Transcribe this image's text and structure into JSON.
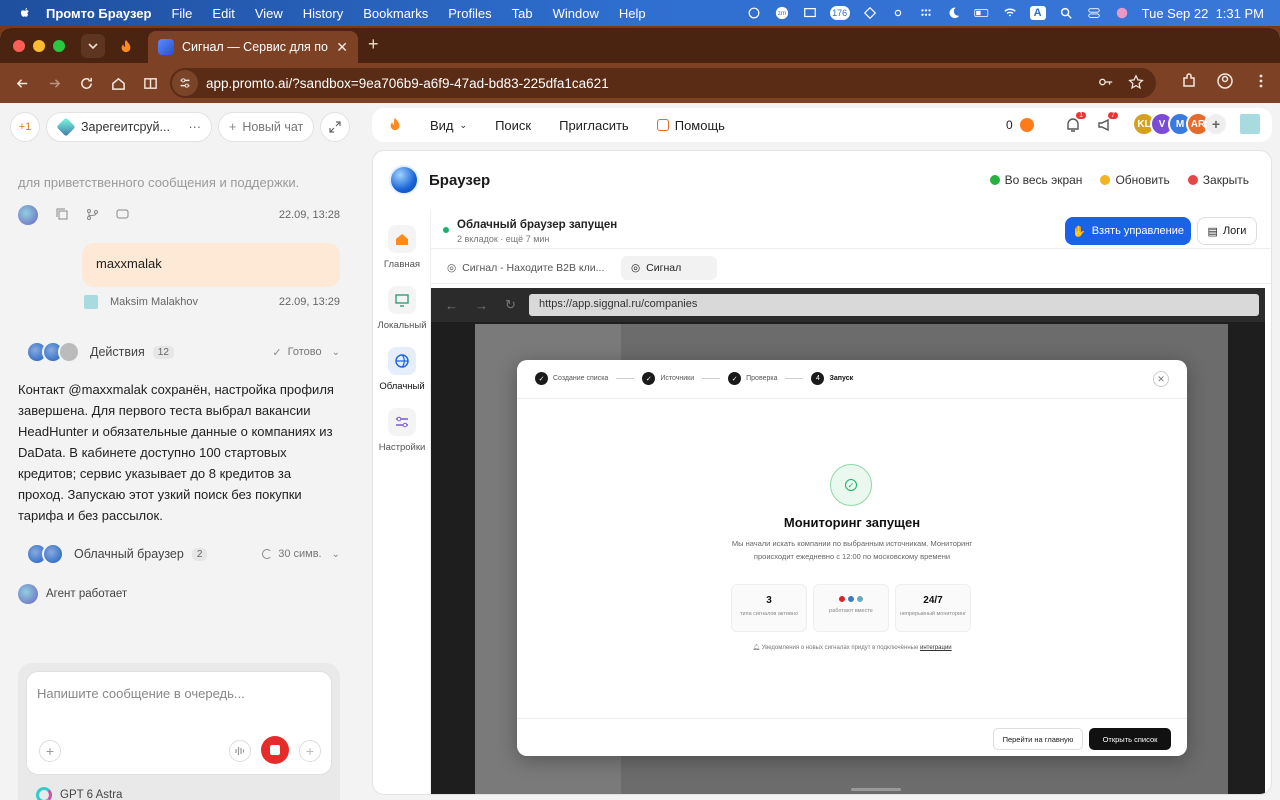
{
  "menubar": {
    "app": "Промто Браузер",
    "menus": [
      "File",
      "Edit",
      "View",
      "History",
      "Bookmarks",
      "Profiles",
      "Tab",
      "Window",
      "Help"
    ],
    "badge_count": "176",
    "input_source": "A",
    "datetime": "Tue Sep 22  1:31 PM"
  },
  "browser": {
    "tab_title": "Сигнал — Сервис для поиск",
    "url": "app.promto.ai/?sandbox=9ea706b9-a6f9-47ad-bd83-225dfa1ca621"
  },
  "left": {
    "chip_plus": "+1",
    "chat_title": "Зарегеитсруй...",
    "chat_more": "···",
    "new_chat": "Новый чат",
    "faded_text": "для приветственного сообщения и поддержки.",
    "msg1_time": "22.09, 13:28",
    "user_message": "maxxmalak",
    "user_name": "Maksim Malakhov",
    "msg2_time": "22.09, 13:29",
    "actions_label": "Действия",
    "actions_count": "12",
    "actions_status": "Готово",
    "paragraph": "Контакт @maxxmalak сохранён, настройка профиля завершена. Для первого теста выбрал вакансии HeadHunter и обязательные данные о компаниях из DaData. В кабинете доступно 100 стартовых кредитов; сервис указывает до 8 кредитов за проход. Запускаю этот узкий поиск без покупки тарифа и без рассылок.",
    "cloud_label": "Облачный браузер",
    "cloud_count": "2",
    "cloud_status": "30 симв.",
    "agent_status": "Агент работает",
    "composer_placeholder": "Напишите сообщение в очередь...",
    "model": "GPT 6 Astra"
  },
  "topbar": {
    "view": "Вид",
    "search": "Поиск",
    "invite": "Пригласить",
    "help": "Помощь",
    "balance": "0",
    "notif_count": "1",
    "announce_count": "7",
    "avatars": [
      "KL",
      "V",
      "M",
      "AR"
    ]
  },
  "panel": {
    "title": "Браузер",
    "fullscreen": "Во весь экран",
    "refresh": "Обновить",
    "close": "Закрыть",
    "side": [
      "Главная",
      "Локальный",
      "Облачный",
      "Настройки"
    ],
    "status_title": "Облачный браузер запущен",
    "status_sub": "2 вкладок · ещё 7 мин",
    "take_control": "Взять управление",
    "logs": "Логи",
    "tabs": [
      "Сигнал - Находите B2B кли...",
      "Сигнал"
    ],
    "vp_url": "https://app.siggnal.ru/companies"
  },
  "modal": {
    "steps": [
      "Создание списка",
      "Источники",
      "Проверка",
      "Запуск"
    ],
    "step4_num": "4",
    "title": "Мониторинг запущен",
    "desc": "Мы начали искать компании по выбранным источникам. Мониторинг происходит ежедневно с 12:00 по московскому времени",
    "stat1_value": "3",
    "stat1_label": "типа сигналов активно",
    "stat2_label": "работают вместе",
    "stat3_value": "24/7",
    "stat3_label": "непрерывный мониторинг",
    "note": "Уведомления о новых сигналах придут в подключённые ",
    "note_link": "интеграции",
    "btn_home": "Перейти на главную",
    "btn_open": "Открыть список"
  },
  "colors": {
    "accent": "#1a63e8",
    "stop": "#e62b2b",
    "bubble": "#fde9d6",
    "chrome": "#7d4226"
  }
}
